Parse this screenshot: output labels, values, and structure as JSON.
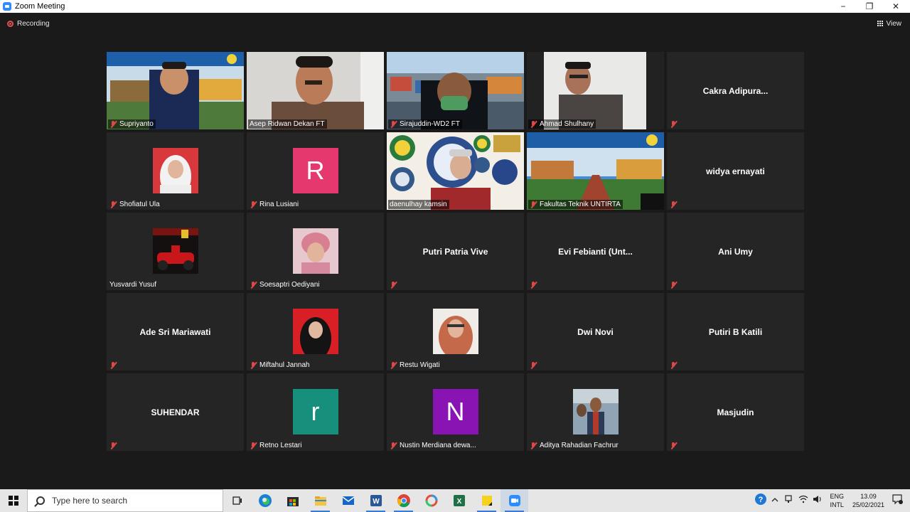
{
  "window": {
    "title": "Zoom Meeting",
    "minimize": "−",
    "maximize": "❐",
    "close": "✕"
  },
  "meeting": {
    "recording_label": "Recording",
    "view_label": "View"
  },
  "participants": [
    {
      "name": "Supriyanto",
      "type": "video",
      "muted": true
    },
    {
      "name": "Asep Ridwan Dekan FT",
      "type": "video",
      "muted": false,
      "speaking": true
    },
    {
      "name": "Sirajuddin-WD2 FT",
      "type": "video",
      "muted": true
    },
    {
      "name": "Ahmad Shulhany",
      "type": "video",
      "muted": true
    },
    {
      "name": "Cakra  Adipura...",
      "type": "name",
      "muted": true
    },
    {
      "name": "Shofiatul Ula",
      "type": "photo",
      "muted": true
    },
    {
      "name": "Rina Lusiani",
      "type": "letter",
      "letter": "R",
      "color": "#e5386e",
      "muted": true
    },
    {
      "name": "daenulhay kamsin",
      "type": "video",
      "muted": false
    },
    {
      "name": "Fakultas Teknik UNTIRTA",
      "type": "video",
      "muted": true
    },
    {
      "name": "widya ernayati",
      "type": "name",
      "muted": true
    },
    {
      "name": "Yusvardi Yusuf",
      "type": "photo",
      "muted": false
    },
    {
      "name": "Soesaptri Oediyani",
      "type": "photo",
      "muted": true
    },
    {
      "name": "Putri Patria Vive",
      "type": "name",
      "muted": true
    },
    {
      "name": "Evi  Febianti  (Unt...",
      "type": "name",
      "muted": true
    },
    {
      "name": "Ani Umy",
      "type": "name",
      "muted": true
    },
    {
      "name": "Ade Sri Mariawati",
      "type": "name",
      "muted": true
    },
    {
      "name": "Miftahul Jannah",
      "type": "photo",
      "muted": true
    },
    {
      "name": "Restu Wigati",
      "type": "photo",
      "muted": true
    },
    {
      "name": "Dwi Novi",
      "type": "name",
      "muted": true
    },
    {
      "name": "Putiri B Katili",
      "type": "name",
      "muted": true
    },
    {
      "name": "SUHENDAR",
      "type": "name",
      "muted": true
    },
    {
      "name": "Retno Lestari",
      "type": "letter",
      "letter": "r",
      "color": "#168f7c",
      "muted": true
    },
    {
      "name": "Nustin Merdiana dewa...",
      "type": "letter",
      "letter": "N",
      "color": "#8a13b3",
      "muted": true
    },
    {
      "name": "Aditya Rahadian Fachrur",
      "type": "photo",
      "muted": true
    },
    {
      "name": "Masjudin",
      "type": "name",
      "muted": true
    }
  ],
  "taskbar": {
    "search_placeholder": "Type here to search",
    "apps": [
      "task-view",
      "edge",
      "store",
      "file-explorer",
      "mail",
      "word",
      "chrome",
      "paint-3d",
      "excel",
      "sticky-notes",
      "zoom"
    ],
    "language_top": "ENG",
    "language_bottom": "INTL",
    "time": "13.09",
    "date": "25/02/2021"
  }
}
